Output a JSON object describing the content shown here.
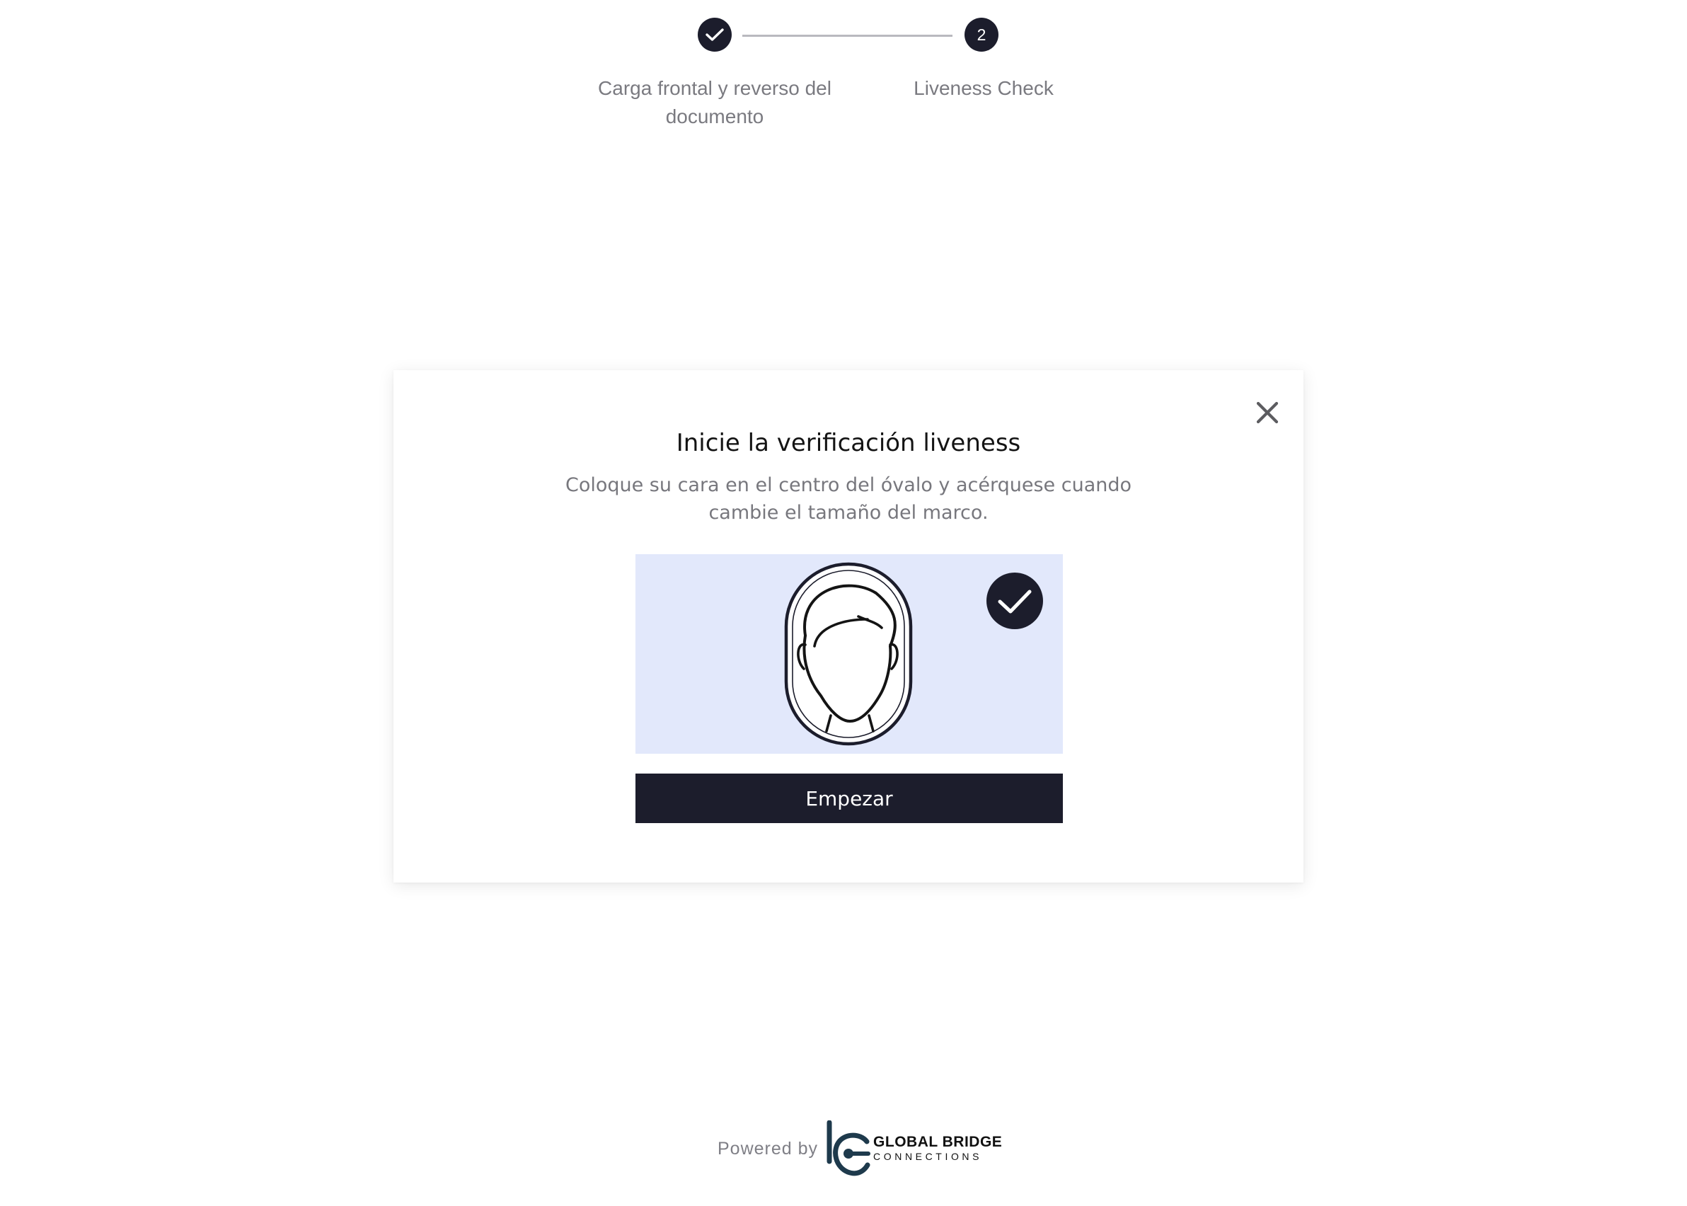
{
  "stepper": {
    "steps": [
      {
        "number": "1",
        "status": "completed",
        "icon": "check-icon",
        "label": "Carga frontal y reverso del documento"
      },
      {
        "number": "2",
        "status": "current",
        "label": "Liveness Check"
      }
    ]
  },
  "modal": {
    "close_icon": "close-icon",
    "title": "Inicie la verificación liveness",
    "subtitle": "Coloque su cara en el centro del óvalo y acérquese cuando cambie el tamaño del marco.",
    "illustration_icons": [
      "face-oval-icon",
      "check-badge-icon"
    ],
    "start_button_label": "Empezar"
  },
  "footer": {
    "powered_by": "Powered by",
    "logo_line1": "GLOBAL BRIDGE",
    "logo_line2": "CONNECTIONS",
    "logo_icon": "global-bridge-logo-icon"
  },
  "colors": {
    "primary_dark": "#1c1d2c",
    "illustration_bg": "#e2e8fb",
    "muted_text": "#77777d",
    "logo_accent": "#1e3a4c"
  }
}
